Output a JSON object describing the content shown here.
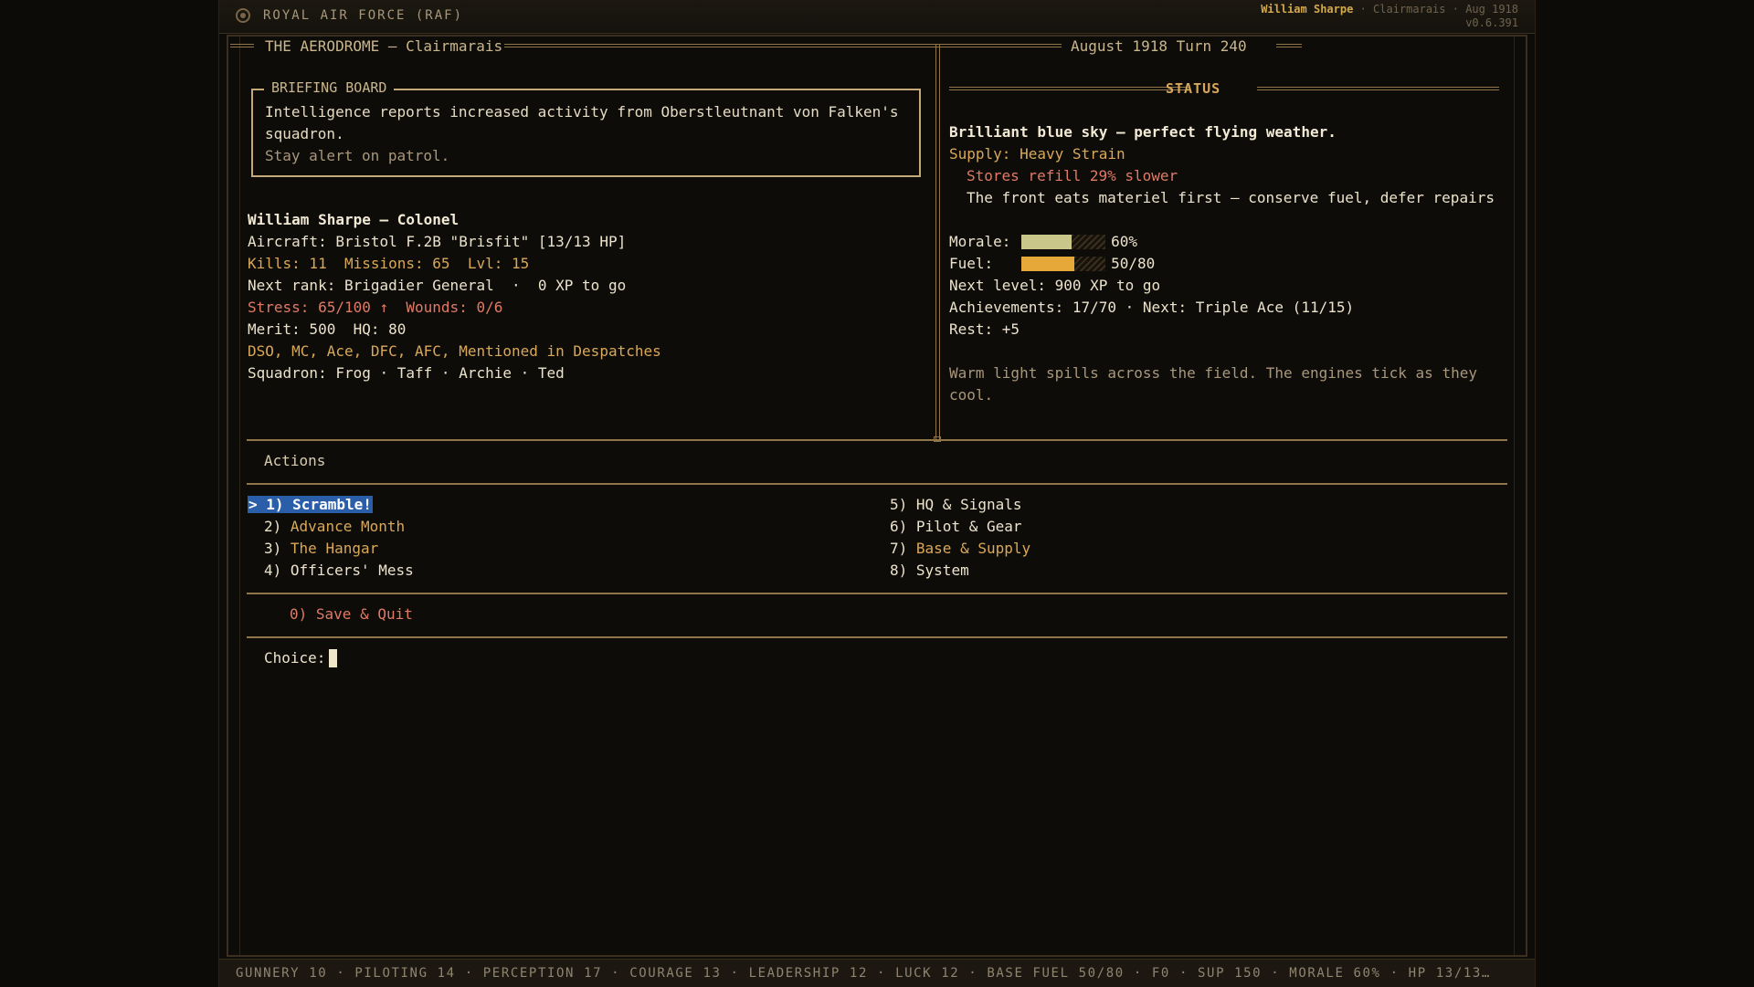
{
  "header": {
    "app_title": "ROYAL AIR FORCE (RAF)",
    "player_name": "William Sharpe",
    "sep1": " · ",
    "location": "Clairmarais",
    "sep2": " · ",
    "date": "Aug 1918",
    "version": "v0.6.391"
  },
  "panel": {
    "title": "THE AERODROME — Clairmarais",
    "date_turn": "August 1918  Turn 240"
  },
  "briefing": {
    "title": "BRIEFING BOARD",
    "text": "Intelligence reports increased activity from Oberstleutnant von Falken's squadron.",
    "note": "Stay alert on patrol."
  },
  "pilot": {
    "name_rank": "William Sharpe — Colonel",
    "aircraft": "Aircraft: Bristol F.2B \"Brisfit\" [13/13 HP]",
    "kills_missions": "Kills: 11  Missions: 65  Lvl: 15",
    "next_rank": "Next rank: Brigadier General  ·  0 XP to go",
    "stress": "Stress: 65/100 ↑",
    "wounds": "Wounds: 0/6",
    "merit_hq": "Merit: 500  HQ: 80",
    "decorations": "DSO, MC, Ace, DFC, AFC, Mentioned in Despatches",
    "squadron": "Squadron: Frog · Taff · Archie · Ted"
  },
  "status": {
    "title": "STATUS",
    "weather": "Brilliant blue sky — perfect flying weather.",
    "supply": "Supply: Heavy Strain",
    "supply_detail": "Stores refill 29% slower",
    "supply_note": "The front eats materiel first — conserve fuel, defer repairs",
    "morale_label": "Morale:",
    "morale_value": "60%",
    "morale_fraction": 0.6,
    "fuel_label": "Fuel:",
    "fuel_value": "50/80",
    "fuel_fraction": 0.625,
    "next_level": "Next level: 900 XP to go",
    "achievements": "Achievements: 17/70 · Next: Triple Ace (11/15)",
    "rest": "Rest: +5",
    "flavor": "Warm light spills across the field. The engines tick as they cool."
  },
  "actions": {
    "title": "Actions",
    "items": [
      {
        "key": "1)",
        "label": "Scramble!",
        "prefix": "> "
      },
      {
        "key": "2)",
        "label": "Advance Month"
      },
      {
        "key": "3)",
        "label": "The Hangar"
      },
      {
        "key": "4)",
        "label": "Officers' Mess"
      },
      {
        "key": "5)",
        "label": "HQ & Signals"
      },
      {
        "key": "6)",
        "label": "Pilot & Gear"
      },
      {
        "key": "7)",
        "label": "Base & Supply"
      },
      {
        "key": "8)",
        "label": "System"
      }
    ],
    "quit": "0) Save & Quit",
    "choice_label": "Choice:"
  },
  "statusbar": "GUNNERY 10 · PILOTING 14 · PERCEPTION 17 · COURAGE 13 · LEADERSHIP 12 · LUCK 12 · BASE FUEL 50/80 · F0 · SUP 150 · MORALE 60% · HP 13/13…",
  "colors": {
    "accent_gold": "#d9a858",
    "warning_red": "#e07a66",
    "selection_blue": "#2b5ea8",
    "morale_bar": "#c9c88a",
    "fuel_bar": "#e6a838"
  }
}
